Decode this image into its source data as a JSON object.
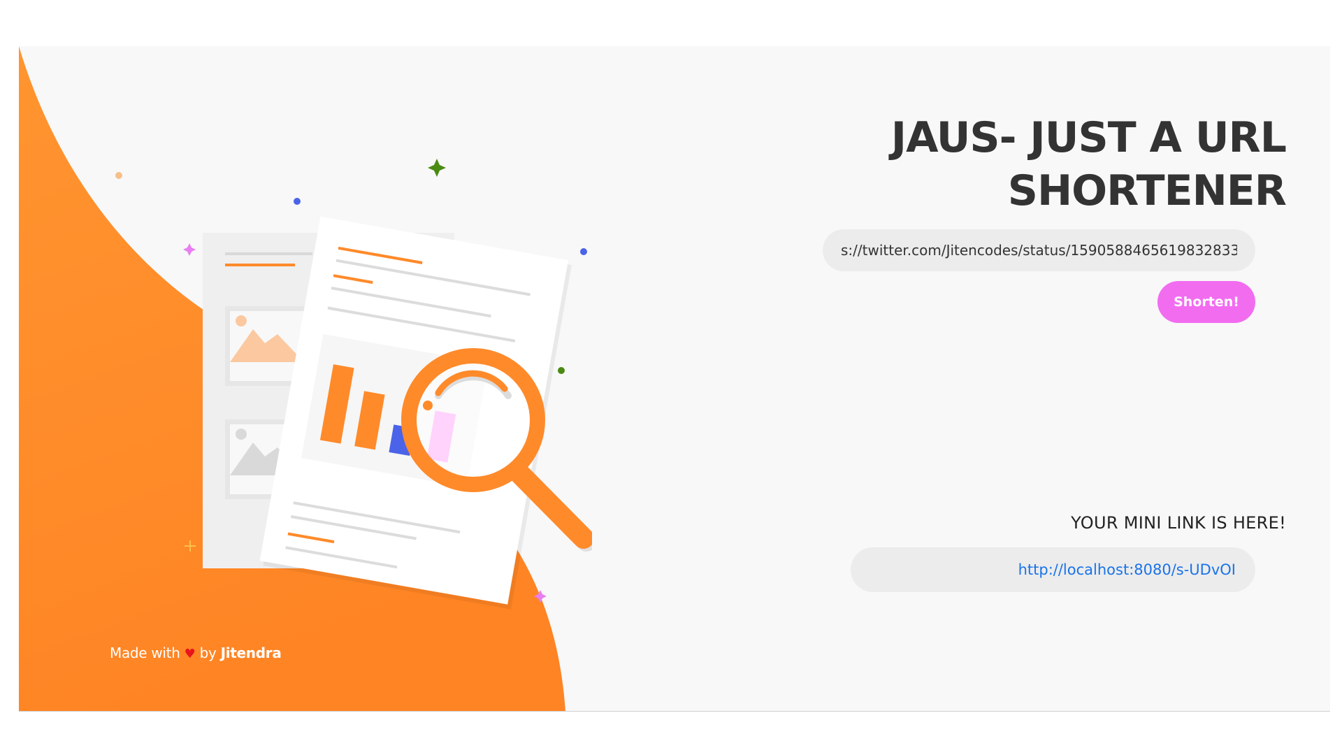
{
  "app": {
    "title": "JAUS- JUST A URL SHORTENER"
  },
  "form": {
    "url_value": "s://twitter.com/Jitencodes/status/1590588465619832833",
    "submit_label": "Shorten!"
  },
  "result": {
    "label": "YOUR MINI LINK IS HERE!",
    "link": "http://localhost:8080/s-UDvOI"
  },
  "footer": {
    "prefix": "Made with",
    "heart": "♥",
    "by": "by",
    "author": "Jitendra"
  },
  "colors": {
    "accent_orange": "#ff8a2a",
    "button_pink": "#f26cf0",
    "link_blue": "#1a73e8"
  },
  "icons": {
    "illustration": "document-search-magnifier-illustration"
  }
}
